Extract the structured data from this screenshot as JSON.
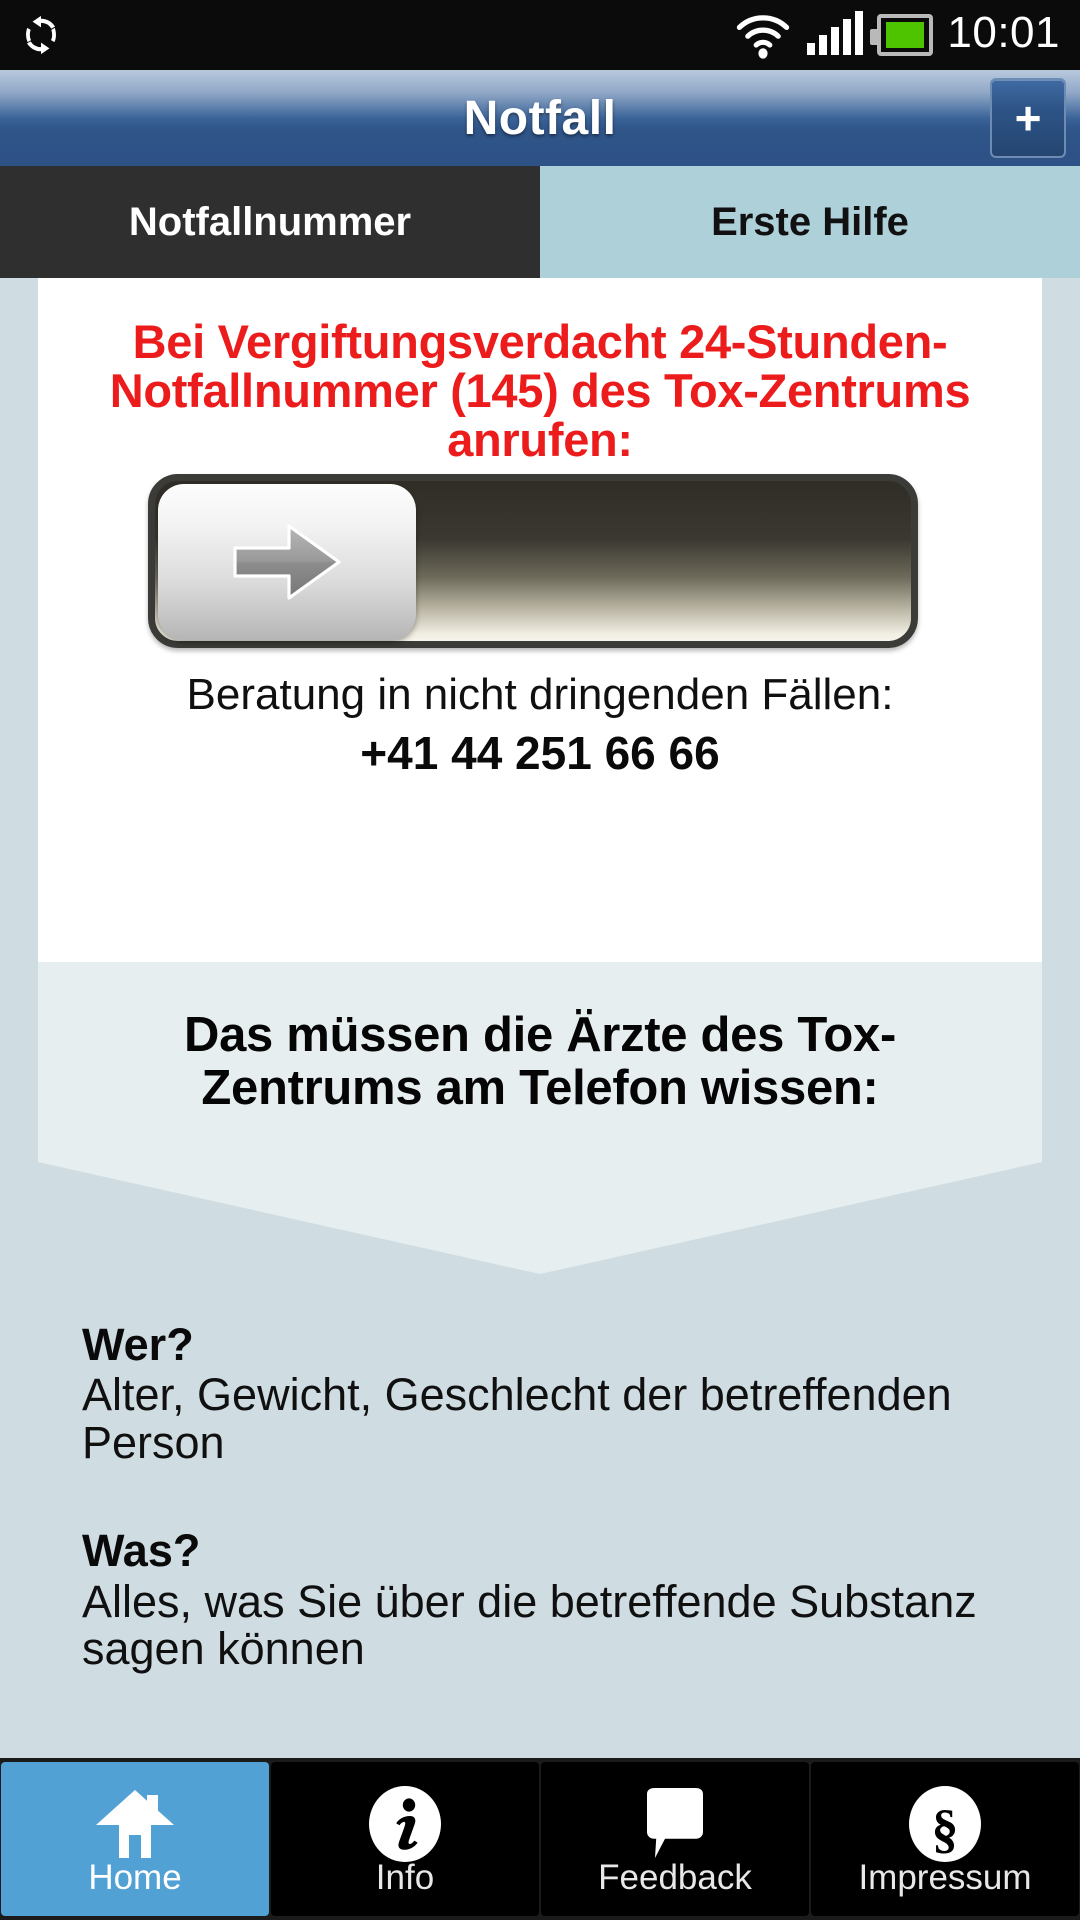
{
  "statusbar": {
    "sync_icon": "sync-icon",
    "wifi_icon": "wifi-icon",
    "signal_icon": "signal-bars-icon",
    "battery_icon": "battery-icon",
    "time": "10:01"
  },
  "titlebar": {
    "title": "Notfall",
    "add_button_label": "+"
  },
  "tabs": [
    {
      "label": "Notfallnummer",
      "active": true
    },
    {
      "label": "Erste Hilfe",
      "active": false
    }
  ],
  "main": {
    "alert_text": "Bei Vergiftungsverdacht 24-Stunden-Notfallnummer (145) des Tox-Zentrums anrufen:",
    "alert_color": "#ec1c1c",
    "slider": {
      "name": "slide-to-call-145",
      "handle_icon": "arrow-right-icon",
      "position_percent": 0
    },
    "advice_label": "Beratung in nicht dringenden Fällen:",
    "advice_phone": "+41 44 251 66 66",
    "banner_text": "Das müssen die Ärzte des Tox-Zentrums am Telefon wissen:",
    "questions": [
      {
        "question": "Wer?",
        "answer": "Alter, Gewicht, Geschlecht der betreffenden Person"
      },
      {
        "question": "Was?",
        "answer": "Alles, was Sie über die betreffende Substanz sagen können"
      }
    ]
  },
  "bottomnav": [
    {
      "label": "Home",
      "icon": "home-icon",
      "active": true
    },
    {
      "label": "Info",
      "icon": "info-circle-icon",
      "active": false
    },
    {
      "label": "Feedback",
      "icon": "speech-bubble-icon",
      "active": false
    },
    {
      "label": "Impressum",
      "icon": "section-sign-circle-icon",
      "active": false
    }
  ],
  "colors": {
    "accent_blue": "#51a1d4",
    "title_blue": "#2e5186",
    "alert_red": "#ec1c1c",
    "page_bg": "#cfdde3",
    "banner_bg": "#e6eef0",
    "tab_active_bg": "#2f2f2f",
    "tab_inactive_bg": "#aed0d8",
    "battery_green": "#4ec400"
  }
}
